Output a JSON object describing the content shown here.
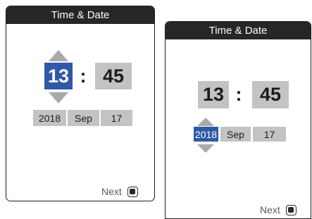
{
  "screens": [
    {
      "title": "Time & Date",
      "hour": "13",
      "separator": ":",
      "minute": "45",
      "year": "2018",
      "month": "Sep",
      "day": "17",
      "next_label": "Next",
      "selected_field": "hour"
    },
    {
      "title": "Time & Date",
      "hour": "13",
      "separator": ":",
      "minute": "45",
      "year": "2018",
      "month": "Sep",
      "day": "17",
      "next_label": "Next",
      "selected_field": "year"
    }
  ],
  "colors": {
    "title_bar": "#262626",
    "selected": "#2f58a8",
    "field": "#c3c3c3",
    "arrow": "#a9a9a9"
  }
}
